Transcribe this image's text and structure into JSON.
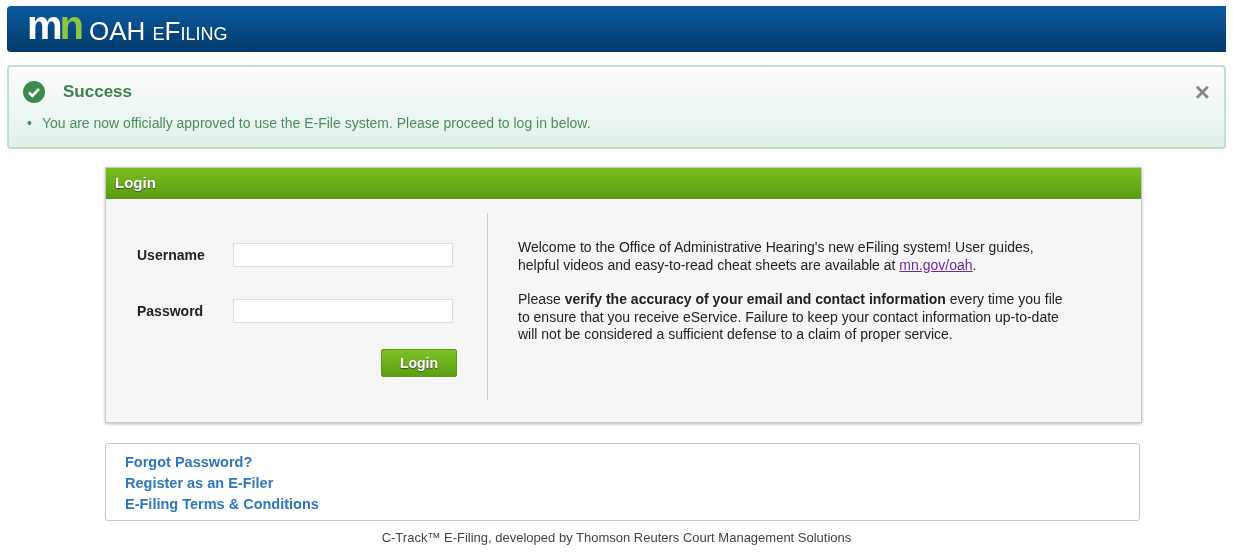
{
  "header": {
    "logo": "mn",
    "title": "OAH eFiling"
  },
  "alert": {
    "title": "Success",
    "close": "×",
    "messages": [
      {
        "bullet": "•",
        "text": "You are now officially approved to use the E-File system. Please proceed to log in below."
      }
    ]
  },
  "login": {
    "title": "Login",
    "fields": [
      {
        "label": "Username"
      },
      {
        "label": "Password"
      }
    ],
    "button": "Login",
    "info": [
      {
        "text": "Welcome to the Office of Administrative Hearing's new eFiling system! User guides, helpful videos and easy-to-read cheat sheets are available at ",
        "link": "mn.gov/oah",
        "after": "."
      },
      {
        "text": "Please **verify the accuracy of your email and contact information** every time you file to ensure that you receive eService. Failure to keep your contact information up-to-date will not be considered a sufficient defense to a claim of proper service."
      }
    ]
  },
  "links": [
    "Forgot Password?",
    "Register as an E-Filer",
    "E-Filing Terms & Conditions"
  ],
  "footer": "C-Track™ E-Filing, developed by Thomson Reuters Court Management Solutions"
}
